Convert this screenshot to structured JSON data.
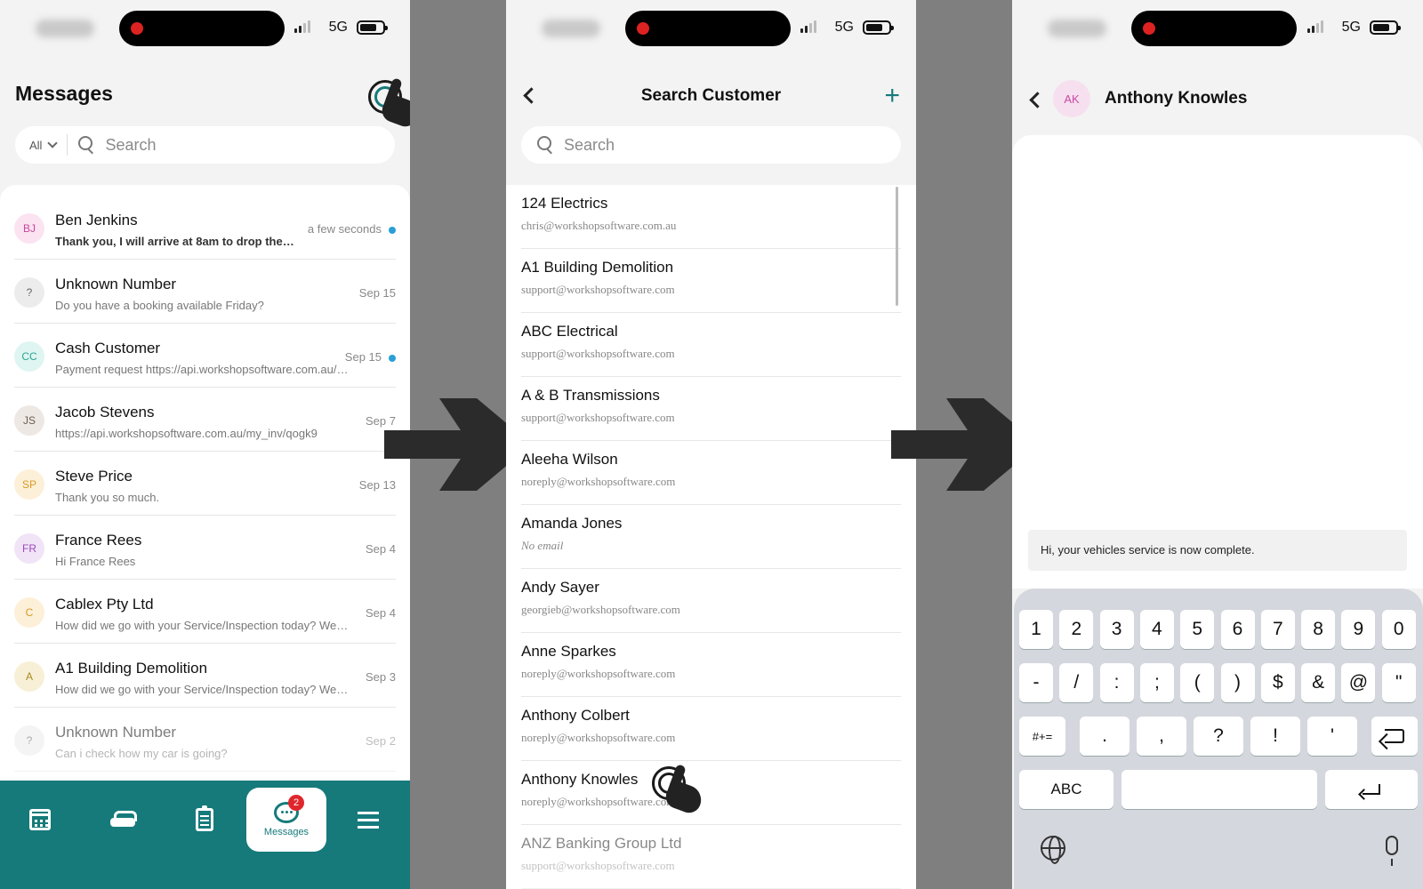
{
  "colors": {
    "brand_teal": "#167a7b",
    "unread_dot": "#2a9fd6",
    "badge_red": "#e0262d",
    "divider_gray": "#7f7f7f"
  },
  "status": {
    "network": "5G"
  },
  "messages_screen": {
    "title": "Messages",
    "filter_label": "All",
    "search_placeholder": "Search",
    "conversations": [
      {
        "initials": "BJ",
        "name": "Ben Jenkins",
        "preview": "Thank you, I will arrive at 8am to drop the car off.",
        "date": "a few seconds",
        "unread": true,
        "avatar_bg": "#fbe3f1",
        "avatar_fg": "#c5479c"
      },
      {
        "initials": "?",
        "name": "Unknown Number",
        "preview": "Do you have a booking available Friday?",
        "date": "Sep 15",
        "unread": false,
        "avatar_bg": "#ececec",
        "avatar_fg": "#666"
      },
      {
        "initials": "CC",
        "name": "Cash Customer",
        "preview": "Payment request https://api.workshopsoftware.com.au/pay",
        "date": "Sep 15",
        "unread": true,
        "avatar_bg": "#dff5f2",
        "avatar_fg": "#2aa592"
      },
      {
        "initials": "JS",
        "name": "Jacob Stevens",
        "preview": "https://api.workshopsoftware.com.au/my_inv/qogk9",
        "date": "Sep 7",
        "unread": false,
        "avatar_bg": "#ede8e4",
        "avatar_fg": "#6b5a50"
      },
      {
        "initials": "SP",
        "name": "Steve Price",
        "preview": "Thank you so much.",
        "date": "Sep 13",
        "unread": false,
        "avatar_bg": "#fdf0d8",
        "avatar_fg": "#d89a26"
      },
      {
        "initials": "FR",
        "name": "France Rees",
        "preview": "Hi France Rees",
        "date": "Sep 4",
        "unread": false,
        "avatar_bg": "#f1e4f7",
        "avatar_fg": "#9a4bbd"
      },
      {
        "initials": "C",
        "name": "Cablex Pty Ltd",
        "preview": "How did we go with your Service/Inspection today? We would love to hear",
        "date": "Sep 4",
        "unread": false,
        "avatar_bg": "#fdf0d8",
        "avatar_fg": "#d89a26"
      },
      {
        "initials": "A",
        "name": "A1 Building Demolition",
        "preview": "How did we go with your Service/Inspection today? We would love to hear",
        "date": "Sep 3",
        "unread": false,
        "avatar_bg": "#f7f0d6",
        "avatar_fg": "#a98a1f"
      },
      {
        "initials": "?",
        "name": "Unknown Number",
        "preview": "Can i check how my car is going?",
        "date": "Sep 2",
        "unread": false,
        "avatar_bg": "#ececec",
        "avatar_fg": "#666"
      }
    ],
    "nav": {
      "messages_label": "Messages",
      "badge_count": "2"
    }
  },
  "search_screen": {
    "title": "Search Customer",
    "add_label": "+",
    "search_placeholder": "Search",
    "customers": [
      {
        "name": "124 Electrics",
        "email": "chris@workshopsoftware.com.au"
      },
      {
        "name": "A1 Building Demolition",
        "email": "support@workshopsoftware.com"
      },
      {
        "name": "ABC Electrical",
        "email": "support@workshopsoftware.com"
      },
      {
        "name": "A & B Transmissions",
        "email": "support@workshopsoftware.com"
      },
      {
        "name": "Aleeha Wilson",
        "email": "noreply@workshopsoftware.com"
      },
      {
        "name": "Amanda Jones",
        "email": "No email"
      },
      {
        "name": "Andy Sayer",
        "email": "georgieb@workshopsoftware.com"
      },
      {
        "name": "Anne Sparkes",
        "email": "noreply@workshopsoftware.com"
      },
      {
        "name": "Anthony Colbert",
        "email": "noreply@workshopsoftware.com"
      },
      {
        "name": "Anthony Knowles",
        "email": "noreply@workshopsoftware.com"
      },
      {
        "name": "ANZ Banking Group Ltd",
        "email": "support@workshopsoftware.com"
      }
    ]
  },
  "chat_screen": {
    "initials": "AK",
    "contact_name": "Anthony Knowles",
    "compose_text": "Hi, your vehicles service is now complete.",
    "keyboard": {
      "row1": [
        "1",
        "2",
        "3",
        "4",
        "5",
        "6",
        "7",
        "8",
        "9",
        "0"
      ],
      "row2": [
        "-",
        "/",
        ":",
        ";",
        "(",
        ")",
        "$",
        "&",
        "@",
        "\""
      ],
      "row3": [
        ".",
        ",",
        "?",
        "!",
        "'"
      ],
      "toggle_symbols": "#+=",
      "toggle_abc": "ABC"
    }
  }
}
